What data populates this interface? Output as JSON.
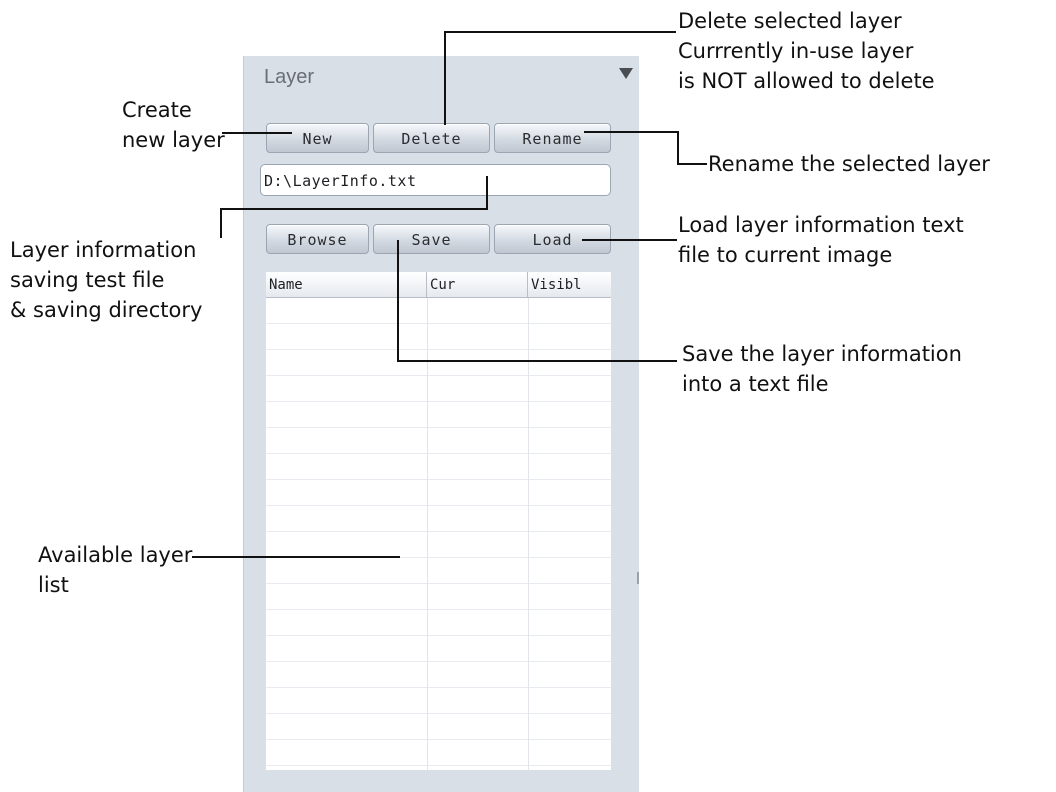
{
  "panel": {
    "title": "Layer",
    "buttons": {
      "new": "New",
      "delete": "Delete",
      "rename": "Rename",
      "browse": "Browse",
      "save": "Save",
      "load": "Load"
    },
    "path_value": "D:\\LayerInfo.txt",
    "menu_icon": "triangle-down-icon",
    "table": {
      "columns": [
        "Name",
        "Cur",
        "Visibl"
      ],
      "rows": []
    }
  },
  "annotations": {
    "create": [
      "Create",
      "new layer"
    ],
    "delete": [
      "Delete selected layer",
      "Currrently in-use layer",
      "is NOT allowed to delete"
    ],
    "rename": "Rename the selected layer",
    "layer_info": [
      "Layer information",
      "saving test file",
      "& saving directory"
    ],
    "load": [
      "Load layer information text",
      "file to current image"
    ],
    "save": [
      "Save the layer information",
      "into a text file"
    ],
    "available": [
      "Available layer",
      "list"
    ]
  }
}
